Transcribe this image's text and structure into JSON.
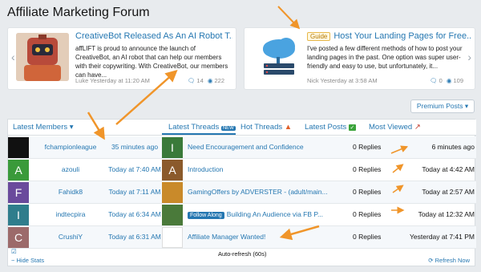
{
  "page": {
    "title": "Affiliate Marketing Forum"
  },
  "cards": [
    {
      "title": "CreativeBot Released As An AI Robot T...",
      "body": "affLIFT is proud to announce the launch of CreativeBot, an AI robot that can help our members with their copywriting. With CreativeBot, our members can have...",
      "author": "Luke",
      "time": "Yesterday at 11:20 AM",
      "replies": "14",
      "views": "222"
    },
    {
      "badge": "Guide",
      "title": "Host Your Landing Pages for Free...",
      "body": "I've posted a few different methods of how to post your landing pages in the past. One option was super user-friendly and easy to use, but unfortunately, it...",
      "author": "Nick",
      "time": "Yesterday at 3:58 AM",
      "replies": "0",
      "views": "109"
    }
  ],
  "premium_label": "Premium Posts",
  "tabs": {
    "latest_members": "Latest Members",
    "latest_threads": "Latest Threads",
    "hot_threads": "Hot Threads",
    "latest_posts": "Latest Posts",
    "most_viewed": "Most Viewed"
  },
  "members": [
    {
      "name": "fchampionleague",
      "time": "35 minutes ago",
      "avatar_color": "#111111",
      "avatar_letter": ""
    },
    {
      "name": "azouli",
      "time": "Today at 7:40 AM",
      "avatar_color": "#3a9a3a",
      "avatar_letter": "A"
    },
    {
      "name": "Fahidk8",
      "time": "Today at 7:11 AM",
      "avatar_color": "#6a4a9c",
      "avatar_letter": "F"
    },
    {
      "name": "indtecpira",
      "time": "Today at 6:34 AM",
      "avatar_color": "#2f7d8c",
      "avatar_letter": "I"
    },
    {
      "name": "CrushiY",
      "time": "Today at 6:31 AM",
      "avatar_color": "#9c6a6a",
      "avatar_letter": "C"
    }
  ],
  "threads": [
    {
      "title": "Need Encouragement and Confidence",
      "replies": "0 Replies",
      "time": "6 minutes ago",
      "avatar_color": "#3a7a3a",
      "avatar_letter": "I"
    },
    {
      "title": "Introduction",
      "replies": "0 Replies",
      "time": "Today at 4:42 AM",
      "avatar_color": "#8b5a2b",
      "avatar_letter": "A"
    },
    {
      "title": "GamingOffers by ADVERSTER - (adult/main...",
      "replies": "0 Replies",
      "time": "Today at 2:57 AM",
      "avatar_color": "#c98a2a",
      "avatar_letter": ""
    },
    {
      "follow": "Follow Along",
      "title": "Building An Audience via FB P...",
      "replies": "0 Replies",
      "time": "Today at 12:32 AM",
      "avatar_color": "#4a7a3a",
      "avatar_letter": ""
    },
    {
      "title": "Affiliate Manager Wanted!",
      "replies": "0 Replies",
      "time": "Yesterday at 7:41 PM",
      "avatar_color": "#ffffff",
      "avatar_letter": ""
    }
  ],
  "footer": {
    "hide_stats": "Hide Stats",
    "auto_refresh": "Auto-refresh (60s)",
    "refresh_now": "Refresh Now"
  },
  "colors": {
    "link": "#2577b1",
    "arrow": "#f0952a"
  }
}
